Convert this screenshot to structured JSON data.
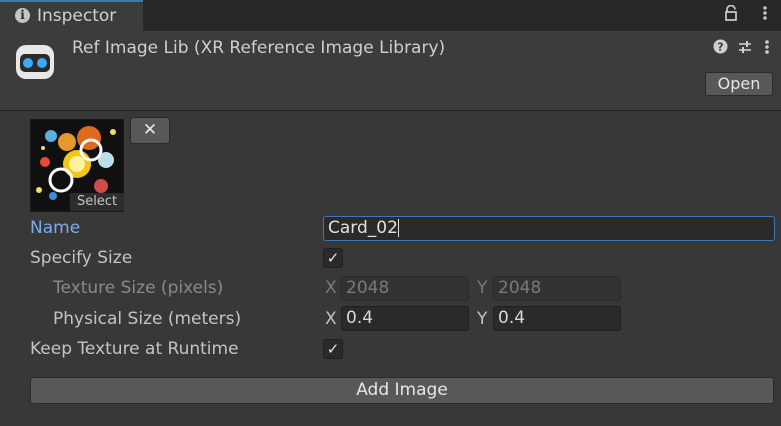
{
  "tab": {
    "label": "Inspector",
    "icon": "info-icon"
  },
  "toolbar": {
    "lock_icon": "lock-icon",
    "menu_icon": "kebab-menu-icon"
  },
  "header": {
    "title": "Ref Image Lib (XR Reference Image Library)",
    "asset_icon": "vr-goggles-icon",
    "help_icon": "help-icon",
    "settings_icon": "preset-sliders-icon",
    "menu_icon": "kebab-menu-icon",
    "open_label": "Open"
  },
  "image_entry": {
    "thumbnail": "solar-system-texture-thumbnail",
    "select_label": "Select",
    "remove_icon": "close-icon",
    "name_label": "Name",
    "name_value": "Card_02",
    "specify_size_label": "Specify Size",
    "specify_size_checked": true,
    "texture_size_label": "Texture Size (pixels)",
    "texture_x_label": "X",
    "texture_x": "2048",
    "texture_y_label": "Y",
    "texture_y": "2048",
    "physical_size_label": "Physical Size (meters)",
    "physical_x_label": "X",
    "physical_x": "0.4",
    "physical_y_label": "Y",
    "physical_y": "0.4",
    "keep_texture_label": "Keep Texture at Runtime",
    "keep_texture_checked": true
  },
  "add_image_label": "Add Image",
  "colors": {
    "accent": "#3a79bb",
    "active_label": "#7bacf0",
    "background": "#383838"
  }
}
